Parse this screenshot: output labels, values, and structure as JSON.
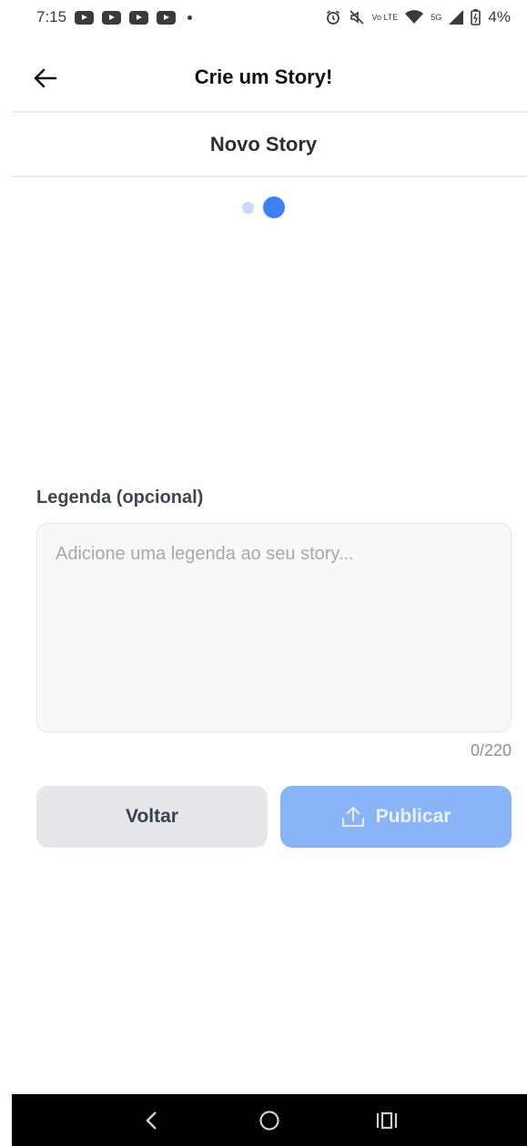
{
  "status_bar": {
    "time": "7:15",
    "battery": "4%",
    "network": "5G",
    "volte": "Vo LTE"
  },
  "header": {
    "title": "Crie um Story!"
  },
  "subtitle": "Novo Story",
  "pager": {
    "total": 2,
    "current": 2
  },
  "caption": {
    "label": "Legenda (opcional)",
    "value": "",
    "placeholder": "Adicione uma legenda ao seu story...",
    "counter": "0/220"
  },
  "buttons": {
    "back_label": "Voltar",
    "publish_label": "Publicar"
  },
  "colors": {
    "accent": "#3b82f6",
    "publish_disabled": "#8ab4f8",
    "secondary_button": "#e5e7eb"
  }
}
